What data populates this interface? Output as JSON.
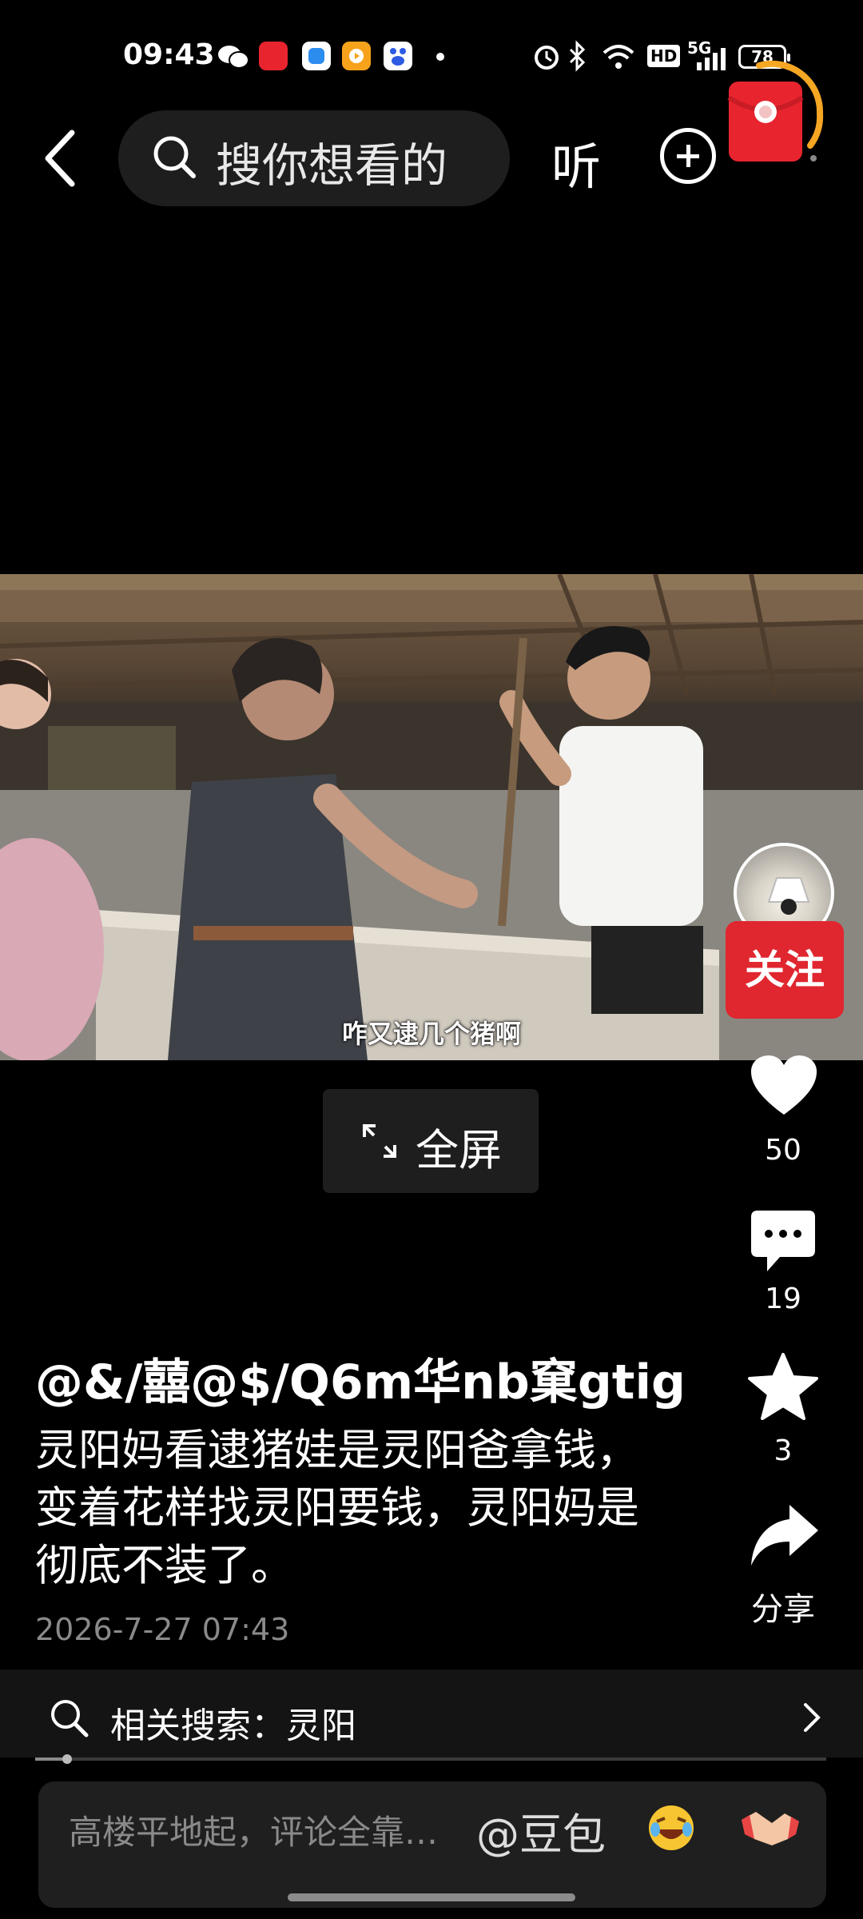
{
  "status": {
    "time": "09:43",
    "network": "5G",
    "hd": "HD",
    "battery": "78"
  },
  "nav": {
    "search_placeholder": "搜你想看的",
    "listen_label": "听"
  },
  "video": {
    "subtitle": "咋又逮几个猪啊",
    "fullscreen_label": "全屏",
    "progress": 0.04
  },
  "side": {
    "follow_label": "关注",
    "likes": "50",
    "comments": "19",
    "favorites": "3",
    "share_label": "分享"
  },
  "post": {
    "author": "@&/囍@$/Q6m华nb窠gtig",
    "description": "灵阳妈看逮猪娃是灵阳爸拿钱，变着花样找灵阳要钱，灵阳妈是彻底不装了。",
    "date": "2026-7-27 07:43"
  },
  "related": {
    "text": "相关搜索：灵阳"
  },
  "comment": {
    "placeholder": "高楼平地起，评论全靠…",
    "mention": "@豆包"
  },
  "colors": {
    "follow_red": "#e0262f",
    "red_packet": "#e8242f",
    "timer_orange": "#f5a623"
  }
}
